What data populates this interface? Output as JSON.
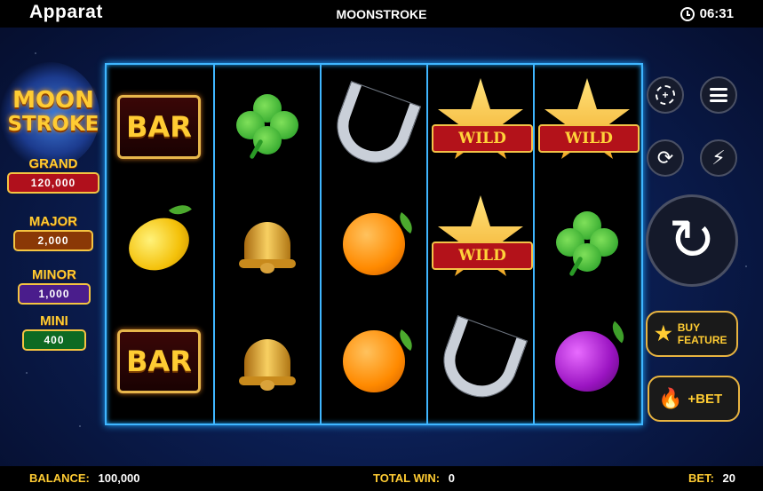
{
  "topbar": {
    "brand": "Apparat",
    "game_title": "MOONSTROKE",
    "time": "06:31"
  },
  "logo": {
    "line1": "MOON",
    "line2": "STROKE"
  },
  "jackpots": [
    {
      "label": "GRAND",
      "value": "120,000"
    },
    {
      "label": "MAJOR",
      "value": "2,000"
    },
    {
      "label": "MINOR",
      "value": "1,000"
    },
    {
      "label": "MINI",
      "value": "400"
    }
  ],
  "reels": [
    [
      "bar",
      "lemon",
      "bar"
    ],
    [
      "clover",
      "bell",
      "bell"
    ],
    [
      "horseshoe",
      "orange",
      "orange"
    ],
    [
      "wild",
      "wild",
      "horseshoe"
    ],
    [
      "wild",
      "clover",
      "plum"
    ]
  ],
  "symbol_text": {
    "bar": "BAR",
    "wild": "WILD"
  },
  "controls": {
    "chip_icon": "chip-icon",
    "menu_icon": "menu-icon",
    "autoplay_icon": "autoplay-icon",
    "turbo_icon": "lightning-icon",
    "spin_icon": "spin-icon",
    "buy_feature_line1": "BUY",
    "buy_feature_line2": "FEATURE",
    "bet_label": "+BET"
  },
  "bottombar": {
    "balance_label": "BALANCE:",
    "balance_value": "100,000",
    "total_win_label": "TOTAL WIN:",
    "total_win_value": "0",
    "bet_label": "BET:",
    "bet_value": "20"
  },
  "colors": {
    "reel_frame": "#3fb6ff",
    "gold": "#ffcc33",
    "background": "#0b1e52"
  }
}
